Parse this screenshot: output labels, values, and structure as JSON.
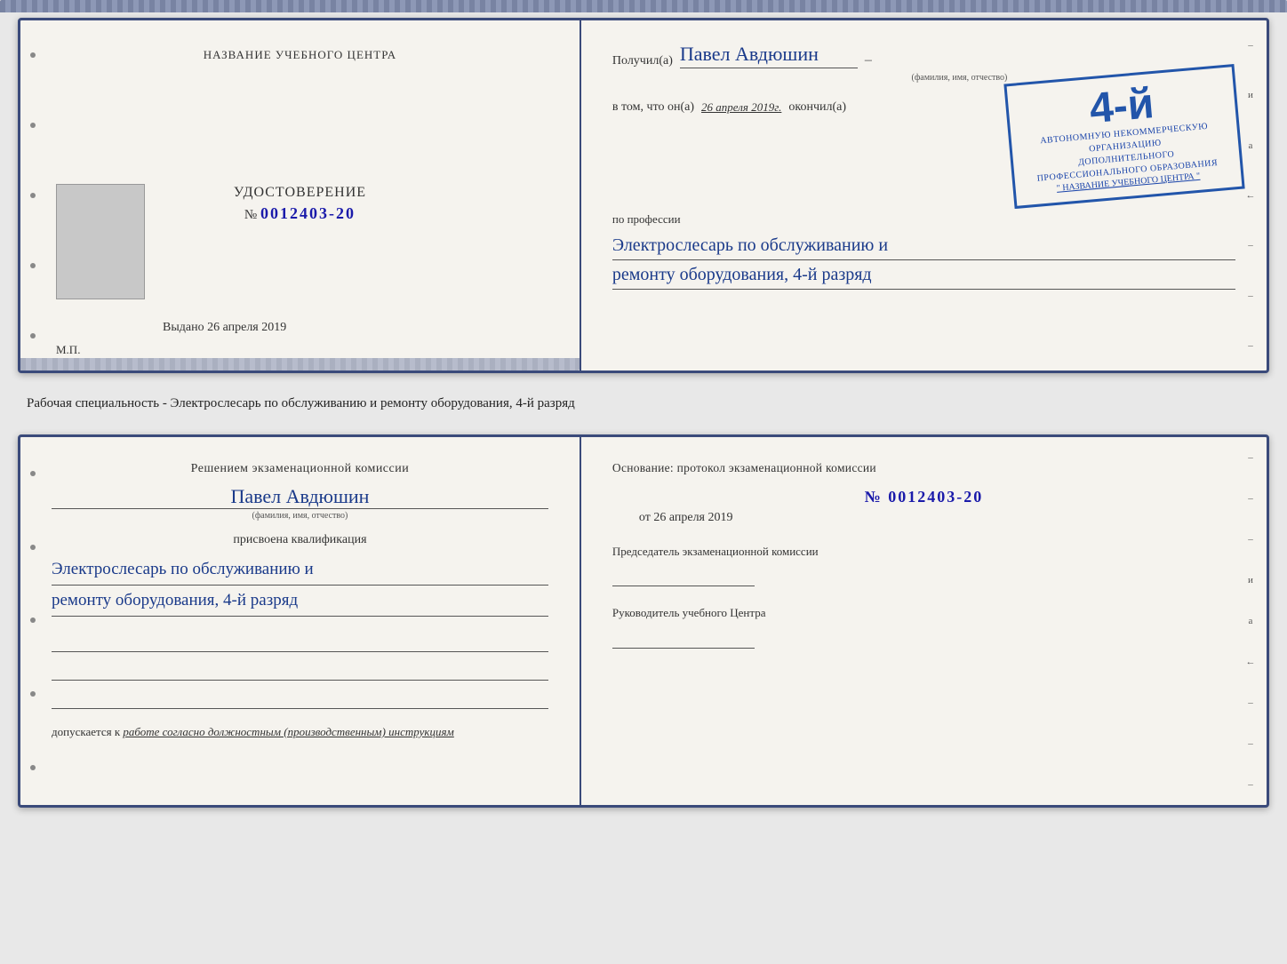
{
  "top_doc": {
    "left": {
      "title": "НАЗВАНИЕ УЧЕБНОГО ЦЕНТРА",
      "udostoverenie_label": "УДОСТОВЕРЕНИЕ",
      "number_prefix": "№",
      "number": "0012403-20",
      "photo_alt": "фото",
      "vydano_label": "Выдано",
      "vydano_date": "26 апреля 2019",
      "mp_label": "М.П."
    },
    "right": {
      "poluchil_label": "Получил(а)",
      "name": "Павел Авдюшин",
      "name_subtitle": "(фамилия, имя, отчество)",
      "vtom_label": "в том, что он(а)",
      "vtom_date": "26 апреля 2019г.",
      "okonchil_label": "окончил(а)",
      "stamp_grade": "4-й",
      "stamp_line1": "АВТОНОМНУЮ НЕКОММЕРЧЕСКУЮ ОРГАНИЗАЦИЮ",
      "stamp_line2": "ДОПОЛНИТЕЛЬНОГО ПРОФЕССИОНАЛЬНОГО ОБРАЗОВАНИЯ",
      "stamp_name": "\" НАЗВАНИЕ УЧЕБНОГО ЦЕНТРА \"",
      "po_professii_label": "по профессии",
      "profession_line1": "Электрослесарь по обслуживанию и",
      "profession_line2": "ремонту оборудования, 4-й разряд"
    }
  },
  "middle": {
    "text": "Рабочая специальность - Электрослесарь по обслуживанию и ремонту оборудования, 4-й разряд"
  },
  "bottom_doc": {
    "left": {
      "resheniyem_label": "Решением экзаменационной комиссии",
      "name": "Павел Авдюшин",
      "name_subtitle": "(фамилия, имя, отчество)",
      "prisvoena_label": "присвоена квалификация",
      "kvalif_line1": "Электрослесарь по обслуживанию и",
      "kvalif_line2": "ремонту оборудования, 4-й разряд",
      "dopuskaetsya_label": "допускается к",
      "dopuskaetsya_value": "работе согласно должностным (производственным) инструкциям"
    },
    "right": {
      "osnovanie_label": "Основание: протокол экзаменационной комиссии",
      "number_prefix": "№",
      "number": "0012403-20",
      "ot_prefix": "от",
      "ot_date": "26 апреля 2019",
      "predsedatel_label": "Председатель экзаменационной комиссии",
      "rukovoditel_label": "Руководитель учебного Центра"
    }
  },
  "binding_chars": [
    "-",
    "и",
    "а",
    "←",
    "-",
    "-",
    "-"
  ]
}
